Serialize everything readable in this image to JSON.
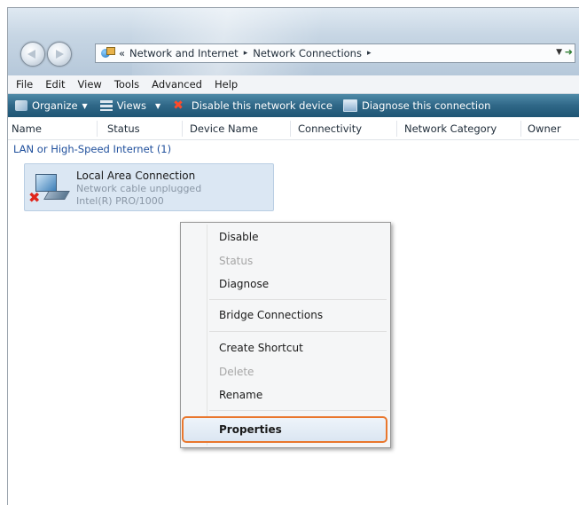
{
  "address": {
    "chevron": "«",
    "crumbs": [
      "Network and Internet",
      "Network Connections"
    ],
    "separator": "▸"
  },
  "menu": [
    "File",
    "Edit",
    "View",
    "Tools",
    "Advanced",
    "Help"
  ],
  "commands": {
    "organize": "Organize",
    "views": "Views",
    "disable": "Disable this network device",
    "diagnose": "Diagnose this connection"
  },
  "columns": [
    "Name",
    "Status",
    "Device Name",
    "Connectivity",
    "Network Category",
    "Owner"
  ],
  "group_header": "LAN or High-Speed Internet (1)",
  "connection": {
    "name": "Local Area Connection",
    "status": "Network cable unplugged",
    "device": "Intel(R) PRO/1000"
  },
  "context_menu": {
    "disable": "Disable",
    "status": "Status",
    "diagnose": "Diagnose",
    "bridge": "Bridge Connections",
    "shortcut": "Create Shortcut",
    "delete": "Delete",
    "rename": "Rename",
    "properties": "Properties"
  },
  "colors": {
    "command_bar": "#2f6787",
    "highlight_border": "#e9772d",
    "group_header": "#1f4f9c"
  }
}
